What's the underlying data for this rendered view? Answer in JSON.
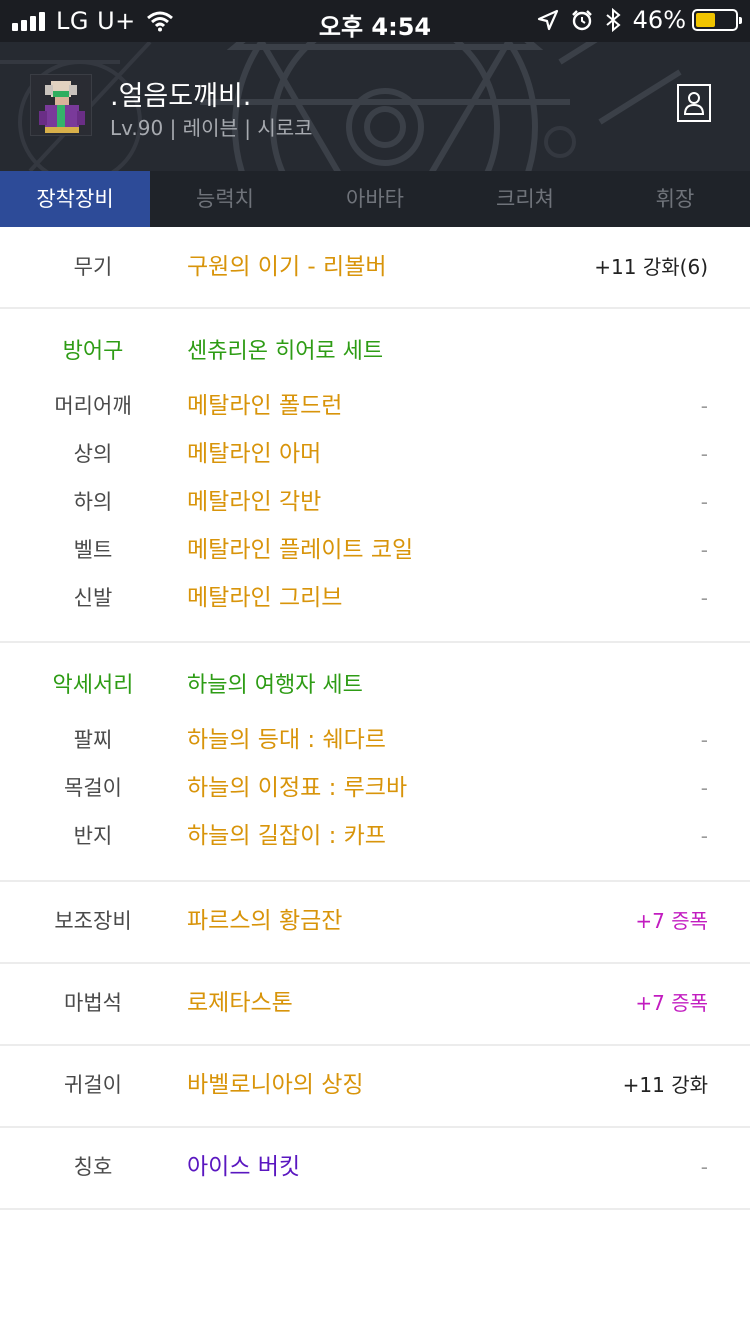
{
  "status_bar": {
    "carrier": "LG U+",
    "time": "오후 4:54",
    "battery_pct": "46%",
    "battery_level": 0.46,
    "battery_color": "#f0c400",
    "icons": [
      "signal-icon",
      "wifi-icon",
      "location-icon",
      "alarm-icon",
      "bluetooth-icon",
      "battery-icon"
    ]
  },
  "character": {
    "name": ".얼음도깨비.",
    "info": "Lv.90 | 레이븐 | 시로코"
  },
  "tabs": [
    {
      "label": "장착장비",
      "active": true
    },
    {
      "label": "능력치",
      "active": false
    },
    {
      "label": "아바타",
      "active": false
    },
    {
      "label": "크리쳐",
      "active": false
    },
    {
      "label": "휘장",
      "active": false
    }
  ],
  "equipment": {
    "weapon": {
      "label": "무기",
      "item": "구원의 이기 - 리볼버",
      "extra": "+11 강화(6)"
    },
    "armor": {
      "label": "방어구",
      "set": "센츄리온 히어로 세트",
      "rows": [
        {
          "label": "머리어깨",
          "item": "메탈라인 폴드런",
          "extra": "-"
        },
        {
          "label": "상의",
          "item": "메탈라인 아머",
          "extra": "-"
        },
        {
          "label": "하의",
          "item": "메탈라인 각반",
          "extra": "-"
        },
        {
          "label": "벨트",
          "item": "메탈라인 플레이트 코일",
          "extra": "-"
        },
        {
          "label": "신발",
          "item": "메탈라인 그리브",
          "extra": "-"
        }
      ]
    },
    "accessory": {
      "label": "악세서리",
      "set": "하늘의 여행자 세트",
      "rows": [
        {
          "label": "팔찌",
          "item": "하늘의 등대 : 쉐다르",
          "extra": "-"
        },
        {
          "label": "목걸이",
          "item": "하늘의 이정표 : 루크바",
          "extra": "-"
        },
        {
          "label": "반지",
          "item": "하늘의 길잡이 : 카프",
          "extra": "-"
        }
      ]
    },
    "sub": {
      "label": "보조장비",
      "item": "파르스의 황금잔",
      "extra": "+7 증폭"
    },
    "magic_stone": {
      "label": "마법석",
      "item": "로제타스톤",
      "extra": "+7 증폭"
    },
    "earring": {
      "label": "귀걸이",
      "item": "바벨로니아의 상징",
      "extra": "+11 강화"
    },
    "title": {
      "label": "칭호",
      "item": "아이스 버킷",
      "extra": "-"
    }
  },
  "colors": {
    "item_orange": "#d8940a",
    "set_green": "#2e9c15",
    "amplify_magenta": "#c21cc0",
    "title_purple": "#5a17c0",
    "tab_active_blue": "#2d4b98"
  }
}
